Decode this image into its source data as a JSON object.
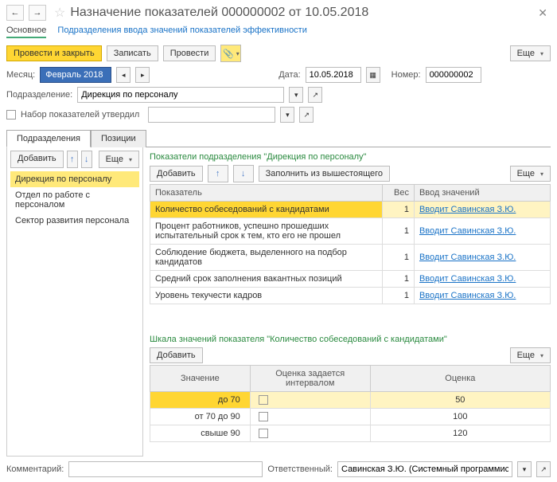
{
  "title": "Назначение показателей 000000002 от 10.05.2018",
  "nav": {
    "main": "Основное",
    "sub": "Подразделения ввода значений показателей эффективности"
  },
  "toolbar": {
    "post_close": "Провести и закрыть",
    "save": "Записать",
    "post": "Провести",
    "more": "Еще"
  },
  "fields": {
    "month_lbl": "Месяц:",
    "month_val": "Февраль 2018",
    "date_lbl": "Дата:",
    "date_val": "10.05.2018",
    "num_lbl": "Номер:",
    "num_val": "000000002",
    "dept_lbl": "Подразделение:",
    "dept_val": "Дирекция по персоналу",
    "approved_lbl": "Набор показателей утвердил"
  },
  "tabs": {
    "dept": "Подразделения",
    "pos": "Позиции"
  },
  "leftbar": {
    "add": "Добавить",
    "more": "Еще"
  },
  "depts": [
    "Дирекция по персоналу",
    "Отдел по работе с персоналом",
    "Сектор развития персонала"
  ],
  "right": {
    "title": "Показатели подразделения \"Дирекция по персоналу\"",
    "add": "Добавить",
    "fill": "Заполнить из вышестоящего",
    "more": "Еще",
    "hdr": {
      "ind": "Показатель",
      "weight": "Вес",
      "input": "Ввод значений"
    },
    "rows": [
      {
        "name": "Количество собеседований с кандидатами",
        "w": "1",
        "who": "Вводит Савинская З.Ю."
      },
      {
        "name": "Процент работников, успешно прошедших испытательный срок к тем, кто его не прошел",
        "w": "1",
        "who": "Вводит Савинская З.Ю."
      },
      {
        "name": "Соблюдение бюджета, выделенного на подбор кандидатов",
        "w": "1",
        "who": "Вводит Савинская З.Ю."
      },
      {
        "name": "Средний срок заполнения вакантных позиций",
        "w": "1",
        "who": "Вводит Савинская З.Ю."
      },
      {
        "name": "Уровень текучести кадров",
        "w": "1",
        "who": "Вводит Савинская З.Ю."
      }
    ]
  },
  "scale": {
    "title": "Шкала значений показателя \"Количество собеседований с кандидатами\"",
    "add": "Добавить",
    "more": "Еще",
    "hdr": {
      "val": "Значение",
      "interval": "Оценка задается интервалом",
      "score": "Оценка"
    },
    "rows": [
      {
        "v": "до 70",
        "s": "50"
      },
      {
        "v": "от 70 до 90",
        "s": "100"
      },
      {
        "v": "свыше 90",
        "s": "120"
      }
    ]
  },
  "footer": {
    "comment_lbl": "Комментарий:",
    "resp_lbl": "Ответственный:",
    "resp_val": "Савинская З.Ю. (Системный программист)"
  }
}
